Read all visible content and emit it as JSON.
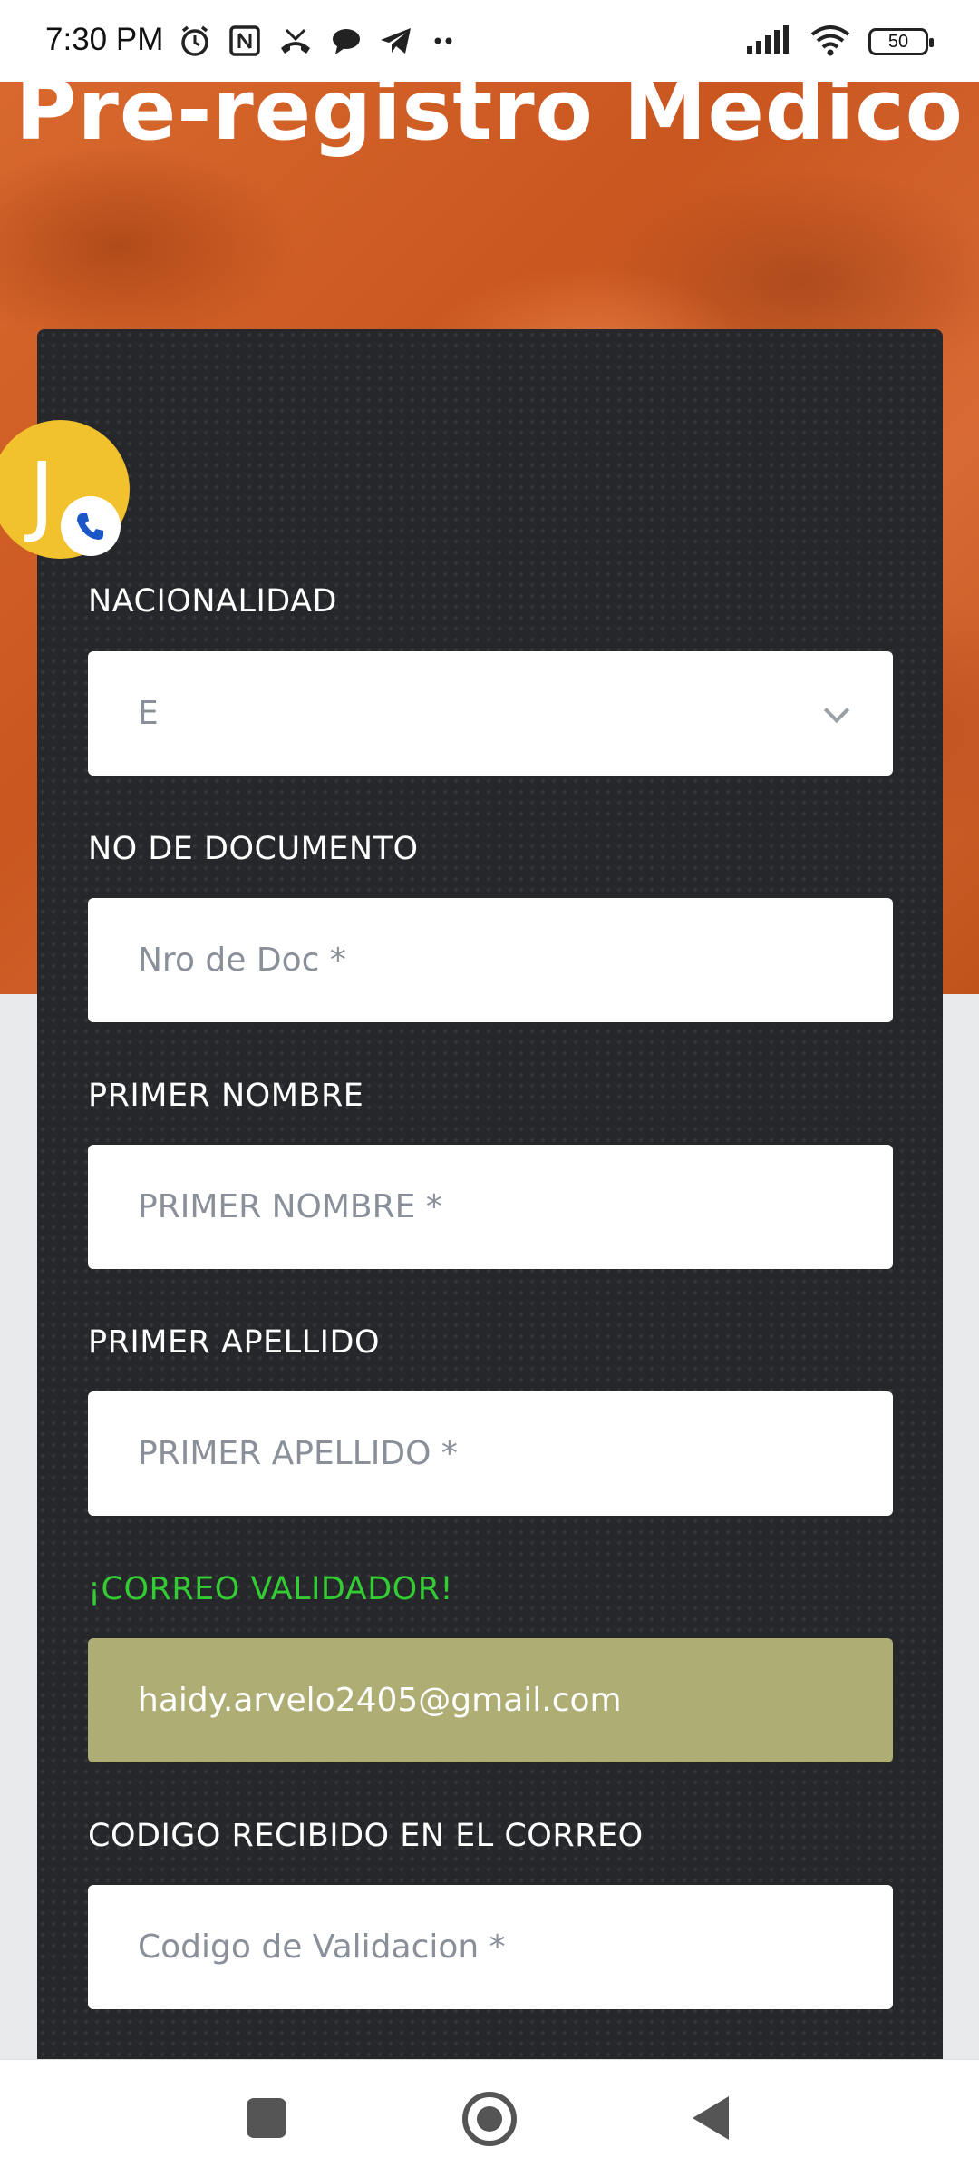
{
  "status_bar": {
    "time": "7:30 PM",
    "battery": "50",
    "left_icons": [
      "alarm-icon",
      "nfc-icon",
      "missed-call-icon",
      "chat-icon",
      "telegram-icon",
      "more-dots-icon"
    ],
    "right_icons": [
      "signal-icon",
      "wifi-icon",
      "battery-icon"
    ]
  },
  "hero": {
    "title": "Pre-registro Medico"
  },
  "bubble": {
    "letter": "J"
  },
  "form": {
    "nacionalidad": {
      "label": "NACIONALIDAD",
      "value": "E"
    },
    "documento": {
      "label": "NO DE DOCUMENTO",
      "placeholder": "Nro de Doc *"
    },
    "primer_nombre": {
      "label": "PRIMER NOMBRE",
      "placeholder": "PRIMER NOMBRE *"
    },
    "primer_apellido": {
      "label": "PRIMER APELLIDO",
      "placeholder": "PRIMER APELLIDO *"
    },
    "correo": {
      "label": "¡CORREO VALIDADOR!",
      "value": "haidy.arvelo2405@gmail.com"
    },
    "codigo": {
      "label": "CODIGO RECIBIDO EN EL CORREO",
      "placeholder": "Codigo de Validacion *"
    }
  },
  "colors": {
    "hero_orange": "#d2612a",
    "card_bg": "#25272b",
    "email_field_bg": "#adad74",
    "validator_label": "#33cc33",
    "bubble": "#f2c12e",
    "phone_icon": "#1a56c8"
  }
}
